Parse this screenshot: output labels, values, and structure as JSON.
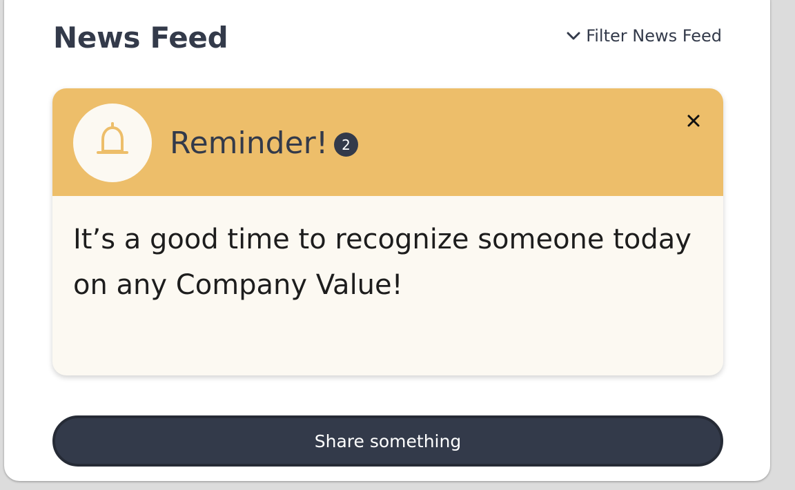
{
  "header": {
    "title": "News Feed",
    "filter_label": "Filter News Feed",
    "filter_icon": "chevron-down-icon"
  },
  "reminder_card": {
    "icon": "bell-icon",
    "title": "Reminder!",
    "badge_count": "2",
    "close_icon": "close-icon",
    "message": "It’s a good time to recognize someone today on any Company Value!",
    "colors": {
      "header_bg": "#edbe6a",
      "body_bg": "#fcf9f2",
      "accent_dark": "#333a4a"
    }
  },
  "actions": {
    "share_label": "Share something"
  }
}
